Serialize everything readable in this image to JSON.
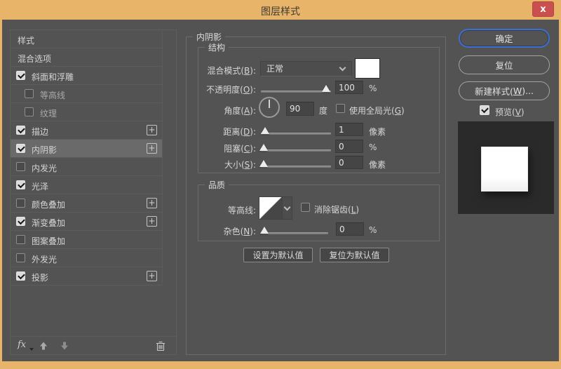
{
  "window": {
    "title": "图层样式",
    "close_glyph": "x"
  },
  "colors": {
    "chrome_tan": "#e7b469",
    "dialog_bg": "#535353",
    "close_red": "#c9504e",
    "focus_blue": "#3d6fd0",
    "selected_row": "#6a6a6a",
    "blend_swatch": "#ffffff"
  },
  "sidebar": {
    "items": [
      {
        "label": "样式"
      },
      {
        "label": "混合选项"
      },
      {
        "label": "斜面和浮雕",
        "checked": true
      },
      {
        "label": "等高线",
        "checked": false
      },
      {
        "label": "纹理",
        "checked": false
      },
      {
        "label": "描边",
        "checked": true,
        "plus": true
      },
      {
        "label": "内阴影",
        "checked": true,
        "plus": true,
        "selected": true
      },
      {
        "label": "内发光",
        "checked": false
      },
      {
        "label": "光泽",
        "checked": true
      },
      {
        "label": "颜色叠加",
        "checked": false,
        "plus": true
      },
      {
        "label": "渐变叠加",
        "checked": true,
        "plus": true
      },
      {
        "label": "图案叠加",
        "checked": false
      },
      {
        "label": "外发光",
        "checked": false
      },
      {
        "label": "投影",
        "checked": true,
        "plus": true
      }
    ],
    "toolbar": {
      "fx_label": "fx"
    }
  },
  "main": {
    "panel_title": "内阴影",
    "structure": {
      "legend": "结构",
      "blend_mode_label": "混合模式(B):",
      "blend_mode_value": "正常",
      "opacity_label": "不透明度(O):",
      "opacity_value": "100",
      "opacity_unit": "%",
      "angle_label": "角度(A):",
      "angle_value": "90",
      "angle_unit": "度",
      "global_light_label": "使用全局光(G)",
      "distance_label": "距离(D):",
      "distance_value": "1",
      "distance_unit": "像素",
      "choke_label": "阻塞(C):",
      "choke_value": "0",
      "choke_unit": "%",
      "size_label": "大小(S):",
      "size_value": "0",
      "size_unit": "像素"
    },
    "quality": {
      "legend": "品质",
      "contour_label": "等高线:",
      "antialias_label": "消除锯齿(L)",
      "noise_label": "杂色(N):",
      "noise_value": "0",
      "noise_unit": "%"
    },
    "set_default_label": "设置为默认值",
    "reset_default_label": "复位为默认值"
  },
  "actions": {
    "ok_label": "确定",
    "reset_label": "复位",
    "new_style_label": "新建样式(W)...",
    "preview_label": "预览(V)"
  }
}
